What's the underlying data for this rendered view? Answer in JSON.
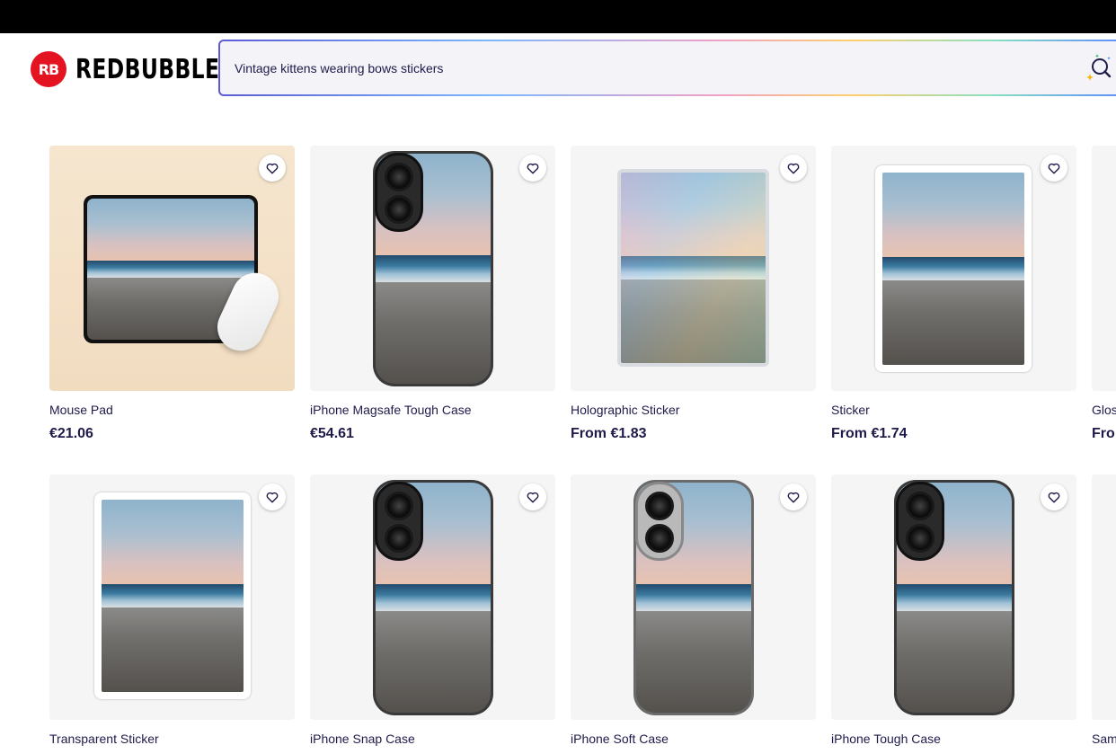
{
  "brand": {
    "logo_mark": "RB",
    "name": "REDBUBBLE"
  },
  "search": {
    "value": "Vintage kittens wearing bows stickers",
    "icon": "ai-search-icon"
  },
  "colors": {
    "brand_red": "#e41321",
    "text": "#1e1b4b"
  },
  "products": [
    {
      "title": "Mouse Pad",
      "price": "€21.06",
      "kind": "mousepad"
    },
    {
      "title": "iPhone Magsafe Tough Case",
      "price": "€54.61",
      "kind": "phone"
    },
    {
      "title": "Holographic Sticker",
      "price": "From €1.83",
      "kind": "holo"
    },
    {
      "title": "Sticker",
      "price": "From €1.74",
      "kind": "sticker"
    },
    {
      "title": "Glos",
      "price": "Fro",
      "kind": "partial"
    },
    {
      "title": "Transparent Sticker",
      "price": "",
      "kind": "sticker-transparent"
    },
    {
      "title": "iPhone Snap Case",
      "price": "",
      "kind": "phone"
    },
    {
      "title": "iPhone Soft Case",
      "price": "",
      "kind": "phone-soft"
    },
    {
      "title": "iPhone Tough Case",
      "price": "",
      "kind": "phone"
    },
    {
      "title": "Sam",
      "price": "",
      "kind": "partial"
    }
  ]
}
